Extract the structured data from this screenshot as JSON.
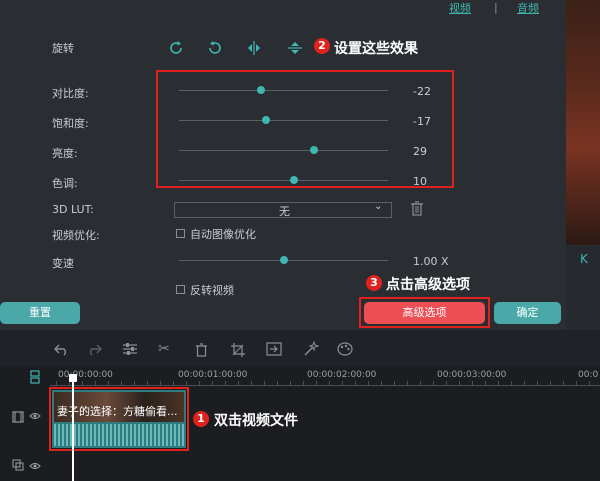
{
  "tabs": {
    "video": "视频",
    "audio": "音频"
  },
  "rotate": {
    "label": "旋转",
    "icons": [
      "rotate-cw-icon",
      "rotate-ccw-icon",
      "flip-horizontal-icon",
      "flip-vertical-icon"
    ]
  },
  "adjustments": [
    {
      "label": "对比度:",
      "value": "-22",
      "level": -22
    },
    {
      "label": "饱和度:",
      "value": "-17",
      "level": -17
    },
    {
      "label": "亮度:",
      "value": "29",
      "level": 29
    },
    {
      "label": "色调:",
      "value": "10",
      "level": 10
    }
  ],
  "lut": {
    "label": "3D LUT:",
    "selected": "无"
  },
  "video_optimize": {
    "label": "视频优化:",
    "checkbox_label": "自动图像优化"
  },
  "speed": {
    "label": "变速",
    "value": "1.00 X"
  },
  "reverse": {
    "checkbox_label": "反转视频"
  },
  "buttons": {
    "reset": "重置",
    "advanced": "高级选项",
    "ok": "确定"
  },
  "annotations": {
    "a1": {
      "badge": "1",
      "text": "双击视频文件"
    },
    "a2": {
      "badge": "2",
      "text": "设置这些效果"
    },
    "a3": {
      "badge": "3",
      "text": "点击高级选项"
    }
  },
  "preview": {
    "k_label": "K"
  },
  "timeline": {
    "ruler": [
      "00:00:00:00",
      "00:00:01:00:00",
      "00:00:02:00:00",
      "00:00:03:00:00",
      "00:0"
    ],
    "clip_title": "妻子的选择：方糖偷看..."
  },
  "colors": {
    "accent": "#3fb6b0",
    "annotation_red": "#e0221f",
    "advanced_button": "#ee4f54"
  }
}
